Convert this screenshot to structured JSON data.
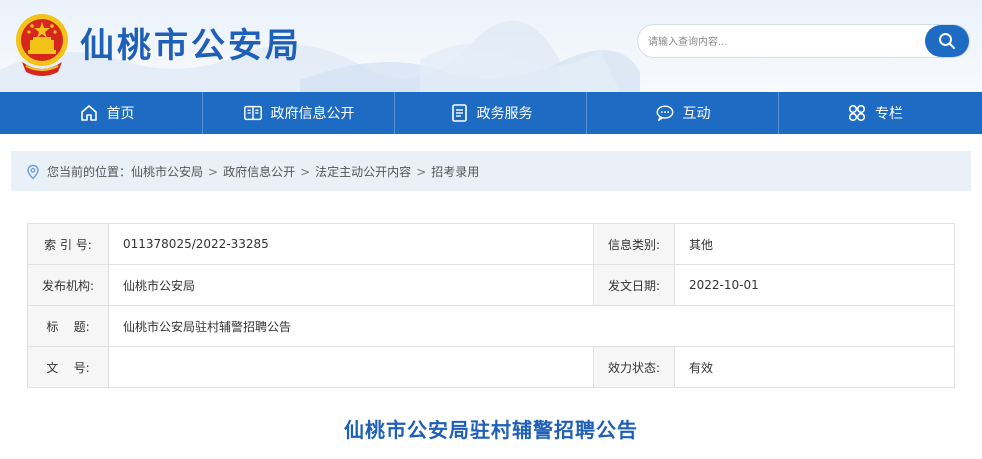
{
  "header": {
    "site_title": "仙桃市公安局",
    "emblem_icon": "national-emblem-icon",
    "search": {
      "placeholder": "请输入查询内容...",
      "button_icon": "search-icon"
    }
  },
  "nav": {
    "items": [
      {
        "label": "首页",
        "icon": "home-icon"
      },
      {
        "label": "政府信息公开",
        "icon": "book-icon"
      },
      {
        "label": "政务服务",
        "icon": "document-icon"
      },
      {
        "label": "互动",
        "icon": "chat-icon"
      },
      {
        "label": "专栏",
        "icon": "grid-icon"
      }
    ]
  },
  "breadcrumb": {
    "prefix": "您当前的位置：",
    "items": [
      "仙桃市公安局",
      "政府信息公开",
      "法定主动公开内容",
      "招考录用"
    ],
    "separator": ">"
  },
  "meta": {
    "index_label": "索 引 号:",
    "index_value": "011378025/2022-33285",
    "category_label": "信息类别:",
    "category_value": "其他",
    "publisher_label": "发布机构:",
    "publisher_value": "仙桃市公安局",
    "date_label": "发文日期:",
    "date_value": "2022-10-01",
    "title_label": "标    题:",
    "title_value": "仙桃市公安局驻村辅警招聘公告",
    "doc_no_label": "文    号:",
    "doc_no_value": "",
    "status_label": "效力状态:",
    "status_value": "有效"
  },
  "article": {
    "title": "仙桃市公安局驻村辅警招聘公告"
  },
  "colors": {
    "brand_blue": "#1e6bc4",
    "title_blue": "#1e5fb8",
    "emblem_red": "#d7261d",
    "emblem_gold": "#f3c318"
  }
}
